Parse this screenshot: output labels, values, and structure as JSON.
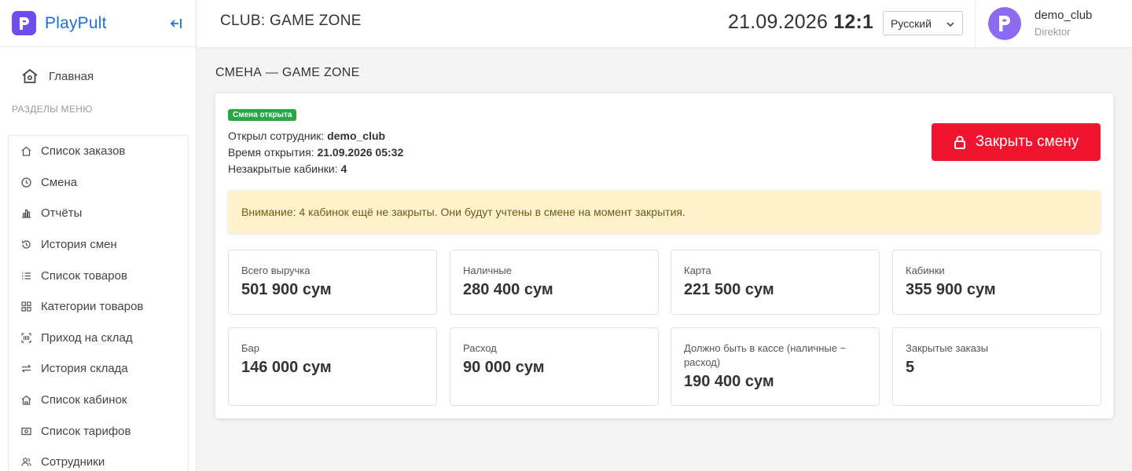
{
  "brand": {
    "name": "PlayPult",
    "logo_letter": "P",
    "color": "#1f6fd8",
    "logo_color": "#6f4cf0"
  },
  "sidebar": {
    "home_label": "Главная",
    "section_caption": "РАЗДЕЛЫ МЕНЮ",
    "items": [
      {
        "label": "Список заказов",
        "icon": "home-icon"
      },
      {
        "label": "Смена",
        "icon": "clock-icon"
      },
      {
        "label": "Отчёты",
        "icon": "bar-chart-icon"
      },
      {
        "label": "История смен",
        "icon": "history-icon"
      },
      {
        "label": "Список товаров",
        "icon": "list-icon"
      },
      {
        "label": "Категории товаров",
        "icon": "grid-icon"
      },
      {
        "label": "Приход на склад",
        "icon": "barcode-icon"
      },
      {
        "label": "История склада",
        "icon": "swap-icon"
      },
      {
        "label": "Список кабинок",
        "icon": "cabin-icon"
      },
      {
        "label": "Список тарифов",
        "icon": "money-icon"
      },
      {
        "label": "Сотрудники",
        "icon": "users-icon"
      }
    ]
  },
  "header": {
    "club_title": "CLUB: GAME ZONE",
    "date": "21.09.2026",
    "time": "12:1",
    "language": "Русский",
    "user": {
      "name": "demo_club",
      "role": "Direktor",
      "avatar_letter": "P"
    }
  },
  "main": {
    "page_title": "СМЕНА — GAME ZONE",
    "badge": "Смена открыта",
    "opened_by_label": "Открыл сотрудник: ",
    "opened_by": "demo_club",
    "open_time_label": "Время открытия: ",
    "open_time": "21.09.2026 05:32",
    "unclosed_label": "Незакрытые кабинки: ",
    "unclosed": "4",
    "close_button": "Закрыть смену",
    "alert": "Внимание: 4 кабинок ещё не закрыты. Они будут учтены в смене на момент закрытия.",
    "stats": [
      {
        "label": "Всего выручка",
        "value": "501 900 сум"
      },
      {
        "label": "Наличные",
        "value": "280 400 сум"
      },
      {
        "label": "Карта",
        "value": "221 500 сум"
      },
      {
        "label": "Кабинки",
        "value": "355 900 сум"
      },
      {
        "label": "Бар",
        "value": "146 000 сум"
      },
      {
        "label": "Расход",
        "value": "90 000 сум"
      },
      {
        "label": "Должно быть в кассе (наличные − расход)",
        "value": "190 400 сум"
      },
      {
        "label": "Закрытые заказы",
        "value": "5"
      }
    ]
  },
  "colors": {
    "danger": "#f0142f",
    "success": "#28a745",
    "warning_bg": "#fef2cd",
    "avatar": "#8b6cf0"
  }
}
